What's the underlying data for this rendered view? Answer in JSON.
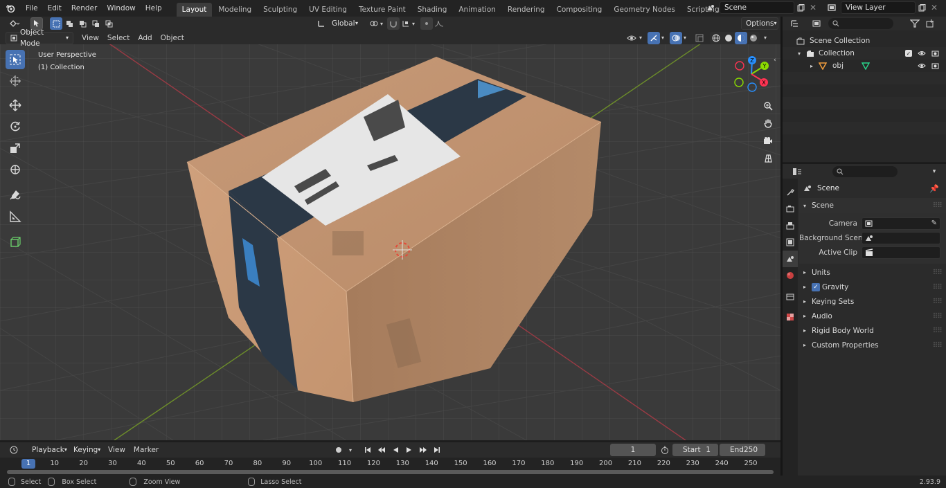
{
  "topbar": {
    "menus": [
      "File",
      "Edit",
      "Render",
      "Window",
      "Help"
    ],
    "workspaces": [
      "Layout",
      "Modeling",
      "Sculpting",
      "UV Editing",
      "Texture Paint",
      "Shading",
      "Animation",
      "Rendering",
      "Compositing",
      "Geometry Nodes",
      "Scripting"
    ],
    "active_workspace": "Layout",
    "add_tab_label": "+",
    "scene_name": "Scene",
    "view_layer_name": "View Layer"
  },
  "viewport_header": {
    "mode": "Object Mode",
    "menus": [
      "View",
      "Select",
      "Add",
      "Object"
    ],
    "orientation": "Global",
    "options_label": "Options"
  },
  "viewport": {
    "perspective_label": "User Perspective",
    "collection_label": "(1) Collection",
    "gizmo_axes": [
      "Z",
      "Y",
      "X"
    ]
  },
  "outliner": {
    "search_placeholder": "",
    "root": "Scene Collection",
    "collection": "Collection",
    "object": "obj"
  },
  "properties": {
    "search_placeholder": "",
    "context_title": "Scene",
    "section_title": "Scene",
    "fields": [
      {
        "label": "Camera",
        "value": ""
      },
      {
        "label": "Background Scene",
        "value": ""
      },
      {
        "label": "Active Clip",
        "value": ""
      }
    ],
    "panels": [
      "Units",
      "Gravity",
      "Keying Sets",
      "Audio",
      "Rigid Body World",
      "Custom Properties"
    ],
    "gravity_checked": true
  },
  "timeline": {
    "menus": [
      "Playback",
      "Keying",
      "View",
      "Marker"
    ],
    "current_frame": "1",
    "start_label": "Start",
    "start_value": "1",
    "end_label": "End",
    "end_value": "250",
    "ruler": [
      "1",
      "10",
      "20",
      "30",
      "40",
      "50",
      "60",
      "70",
      "80",
      "90",
      "100",
      "110",
      "120",
      "130",
      "140",
      "150",
      "160",
      "170",
      "180",
      "190",
      "200",
      "210",
      "220",
      "230",
      "240",
      "250"
    ]
  },
  "statusbar": {
    "hints": [
      "Select",
      "Box Select",
      "Zoom View",
      "Lasso Select"
    ],
    "version": "2.93.9"
  },
  "colors": {
    "accent": "#4772b3",
    "x_axis": "#ff3352",
    "y_axis": "#8bdc00",
    "z_axis": "#2890ff"
  }
}
